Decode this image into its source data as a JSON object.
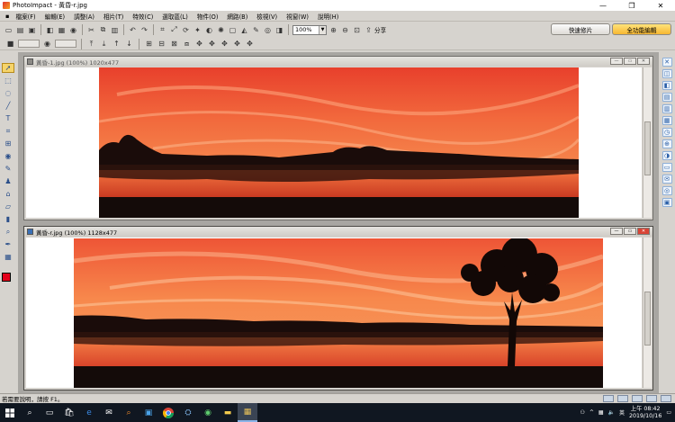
{
  "window": {
    "title": "PhotoImpact - 黃昏-r.jpg",
    "minimize": "—",
    "maximize": "❐",
    "close": "✕"
  },
  "menu": [
    "檔案(F)",
    "編輯(E)",
    "調整(A)",
    "相片(T)",
    "特效(C)",
    "選取區(L)",
    "物件(O)",
    "網路(B)",
    "檢視(V)",
    "視窗(W)",
    "說明(H)"
  ],
  "toolbar": {
    "zoom": "100%",
    "share_label": "分享"
  },
  "mode_tabs": {
    "quick": "快速修片",
    "full": "全功能編輯"
  },
  "documents": [
    {
      "title": "黃昏-1.jpg (100%) 1020x477",
      "active": false
    },
    {
      "title": "黃昏-r.jpg (100%) 1128x477",
      "active": true
    }
  ],
  "status": {
    "text": "若需要說明，請按 F1。"
  },
  "taskbar": {
    "apps": [
      "search-icon",
      "taskview-icon",
      "store-icon",
      "edge-icon",
      "mail-icon",
      "search-app-icon",
      "photos-icon",
      "chrome-icon",
      "network-icon",
      "media-icon",
      "folder-icon",
      "photoimpact-icon"
    ],
    "ime": "英",
    "time": "上午 08:42",
    "date": "2019/10/16"
  },
  "colors": {
    "foreground": "#e4001a",
    "background": "#ffffff"
  }
}
